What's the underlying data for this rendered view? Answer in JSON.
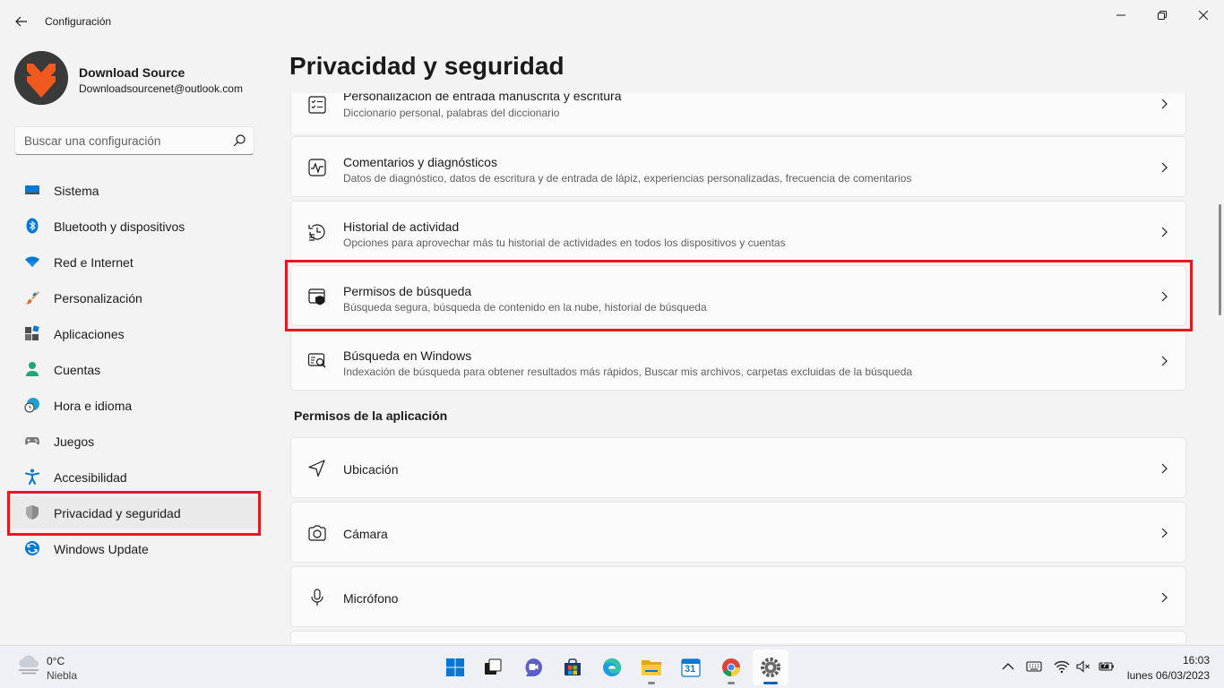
{
  "window": {
    "title": "Configuración"
  },
  "profile": {
    "name": "Download Source",
    "email": "Downloadsourcenet@outlook.com"
  },
  "search": {
    "placeholder": "Buscar una configuración"
  },
  "sidebar": {
    "items": [
      {
        "label": "Sistema",
        "icon": "monitor-icon"
      },
      {
        "label": "Bluetooth y dispositivos",
        "icon": "bluetooth-icon"
      },
      {
        "label": "Red e Internet",
        "icon": "wifi-icon"
      },
      {
        "label": "Personalización",
        "icon": "brush-icon"
      },
      {
        "label": "Aplicaciones",
        "icon": "apps-icon"
      },
      {
        "label": "Cuentas",
        "icon": "person-icon"
      },
      {
        "label": "Hora e idioma",
        "icon": "globe-clock-icon"
      },
      {
        "label": "Juegos",
        "icon": "gamepad-icon"
      },
      {
        "label": "Accesibilidad",
        "icon": "accessibility-icon"
      },
      {
        "label": "Privacidad y seguridad",
        "icon": "shield-icon",
        "active": true
      },
      {
        "label": "Windows Update",
        "icon": "update-icon"
      }
    ]
  },
  "main": {
    "title": "Privacidad y seguridad",
    "cards": [
      {
        "title": "Personalización de entrada manuscrita y escritura",
        "subtitle": "Diccionario personal, palabras del diccionario",
        "icon": "handwriting-icon"
      },
      {
        "title": "Comentarios y diagnósticos",
        "subtitle": "Datos de diagnóstico, datos de escritura y de entrada de lápiz, experiencias personalizadas, frecuencia de comentarios",
        "icon": "diagnostics-icon"
      },
      {
        "title": "Historial de actividad",
        "subtitle": "Opciones para aprovechar más tu historial de actividades en todos los dispositivos y cuentas",
        "icon": "history-icon"
      },
      {
        "title": "Permisos de búsqueda",
        "subtitle": "Búsqueda segura, búsqueda de contenido en la nube, historial de búsqueda",
        "icon": "search-permissions-icon"
      },
      {
        "title": "Búsqueda en Windows",
        "subtitle": "Indexación de búsqueda para obtener resultados más rápidos, Buscar mis archivos, carpetas excluidas de la búsqueda",
        "icon": "windows-search-icon"
      }
    ],
    "section_label": "Permisos de la aplicación",
    "app_cards": [
      {
        "title": "Ubicación",
        "icon": "location-icon"
      },
      {
        "title": "Cámara",
        "icon": "camera-icon"
      },
      {
        "title": "Micrófono",
        "icon": "microphone-icon"
      }
    ]
  },
  "taskbar": {
    "weather": {
      "temp": "0°C",
      "desc": "Niebla"
    },
    "apps": [
      "start-icon",
      "taskview-icon",
      "chat-icon",
      "store-icon",
      "edge-icon",
      "explorer-icon",
      "calendar-icon",
      "chrome-icon",
      "settings-icon"
    ],
    "calendar_day": "31",
    "clock": {
      "time": "16:03",
      "date": "lunes 06/03/2023"
    }
  },
  "colors": {
    "accent": "#005fb8",
    "highlight": "#e11b22"
  }
}
